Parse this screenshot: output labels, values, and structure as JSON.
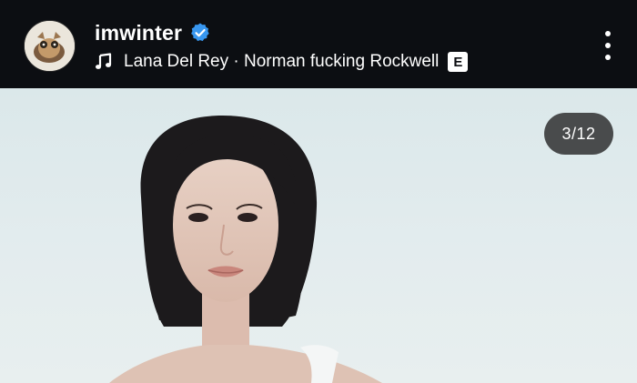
{
  "post": {
    "username": "imwinter",
    "verified": true,
    "music": {
      "artist_track": "Lana Del Rey · Norman fucking Rockwell",
      "explicit_badge": "E"
    },
    "media_counter": "3/12"
  },
  "icons": {
    "avatar": "avatar-icon",
    "verified": "verified-badge-icon",
    "music": "music-note-icon",
    "more": "more-vertical-icon"
  },
  "colors": {
    "header_bg": "#0c0e12",
    "verified_blue": "#3897f0",
    "photo_bg": "#dfeaec",
    "counter_bg": "#3a3a3a"
  }
}
